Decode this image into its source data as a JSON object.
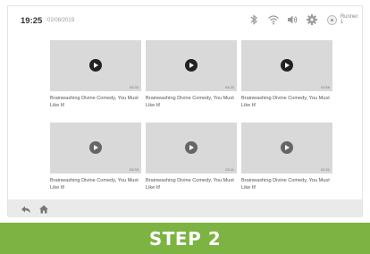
{
  "status": {
    "time": "19:25",
    "date": "02/08/2019",
    "user_name": "Runner 1"
  },
  "icons": {
    "bluetooth": "bluetooth-icon",
    "wifi": "wifi-icon",
    "volume": "volume-icon",
    "settings": "gear-icon",
    "avatar": "user-avatar-icon",
    "back": "back-arrow-icon",
    "home": "home-icon"
  },
  "videos": [
    {
      "title": "Brainwashing Divine Comedy, You Must Like It!",
      "duration": "03:33"
    },
    {
      "title": "Brainwashing Divine Comedy, You Must Like It!",
      "duration": "04:23"
    },
    {
      "title": "Brainwashing Divine Comedy, You Must Like It!",
      "duration": "03:56"
    },
    {
      "title": "Brainwashing Divine Comedy, You Must Like It!",
      "duration": "03:33"
    },
    {
      "title": "Brainwashing Divine Comedy, You Must Like It!",
      "duration": "03:11"
    },
    {
      "title": "Brainwashing Divine Comedy, You Must Like It!",
      "duration": "02:31"
    }
  ],
  "banner": {
    "label": "STEP 2"
  },
  "colors": {
    "banner": "#7cb342",
    "thumbnail": "#d9d9d9",
    "navbar": "#eaeaea"
  }
}
